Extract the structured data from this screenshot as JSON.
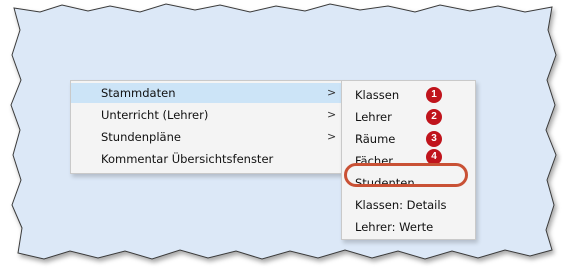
{
  "menu": {
    "items": [
      {
        "label": "Stammdaten",
        "arrow": ">"
      },
      {
        "label": "Unterricht (Lehrer)",
        "arrow": ">"
      },
      {
        "label": "Stundenpläne",
        "arrow": ">"
      },
      {
        "label": "Kommentar Übersichtsfenster",
        "arrow": ""
      }
    ]
  },
  "submenu": {
    "items": [
      {
        "label": "Klassen",
        "badge": "1"
      },
      {
        "label": "Lehrer",
        "badge": "2"
      },
      {
        "label": "Räume",
        "badge": "3"
      },
      {
        "label": "Fächer",
        "badge": "4"
      },
      {
        "label": "Studenten",
        "badge": ""
      },
      {
        "label": "Klassen: Details",
        "badge": ""
      },
      {
        "label": "Lehrer: Werte",
        "badge": ""
      }
    ]
  },
  "colors": {
    "background": "#dce8f7",
    "active_item": "#cce4f7",
    "badge": "#c0141c",
    "highlight": "#c95135"
  },
  "icons": {
    "submenu_arrow": "chevron-right-icon",
    "annotation": "numbered-badge-icon",
    "emphasis": "highlight-ring-icon"
  }
}
